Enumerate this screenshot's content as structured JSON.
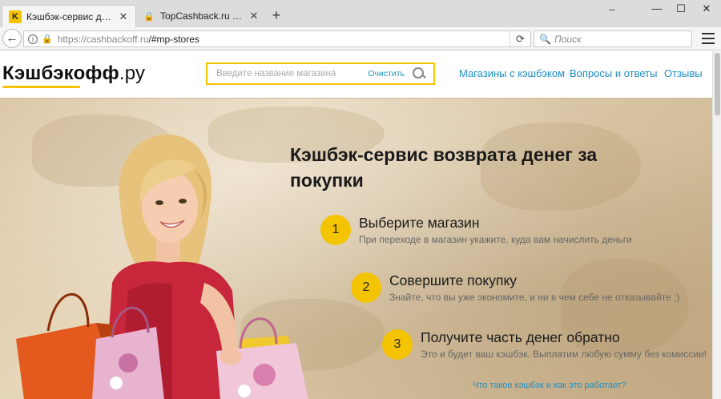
{
  "browser": {
    "tabs": [
      {
        "title": "Кэшбэк-сервис для возвр…",
        "active": true
      },
      {
        "title": "TopCashback.ru - Топ лу…",
        "active": false
      }
    ],
    "new_tab": "+",
    "url_host": "https://cashbackoff.ru",
    "url_path": "/#mp-stores",
    "search_placeholder": "Поиск",
    "window_menu_icon": "↔",
    "minimize_icon": "—",
    "maximize_icon": "☐",
    "close_icon": "✕"
  },
  "site": {
    "logo_bold": "Кэшбэкофф",
    "logo_suffix": ".ру",
    "search_placeholder": "Введите название магазина",
    "search_clear": "Очистить",
    "nav": [
      "Магазины с кэшбэком",
      "Вопросы и ответы",
      "Отзывы"
    ]
  },
  "hero": {
    "title": "Кэшбэк-сервис возврата денег за покупки",
    "steps": [
      {
        "num": "1",
        "title": "Выберите магазин",
        "desc": "При переходе в магазин укажите, куда вам начислить деньги"
      },
      {
        "num": "2",
        "title": "Совершите покупку",
        "desc": "Знайте, что вы уже экономите, и ни в чем себе не отказывайте ;)"
      },
      {
        "num": "3",
        "title": "Получите часть денег обратно",
        "desc": "Это и будет ваш кэшбэк. Выплатим любую сумму без комиссии!"
      }
    ],
    "how_link": "Что такое кэшбэк и как это работает?"
  },
  "colors": {
    "accent_yellow": "#f5c400",
    "link_blue": "#1f8fc2"
  }
}
